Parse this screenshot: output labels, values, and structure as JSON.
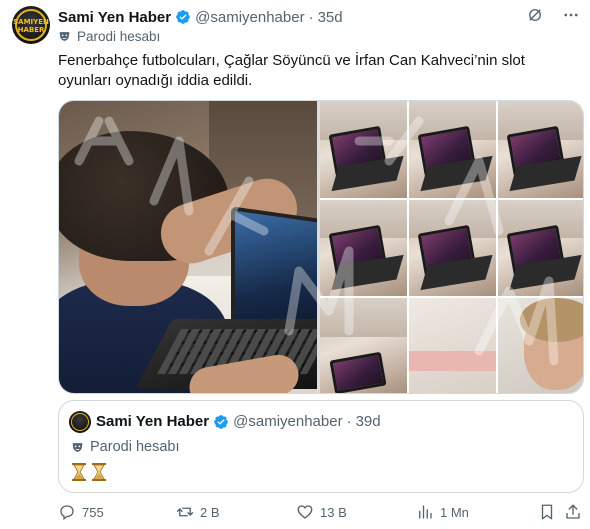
{
  "tweet": {
    "author": {
      "name": "Sami Yen Haber",
      "handle": "@samiyenhaber",
      "separator": "·",
      "time": "35d"
    },
    "avatar_text": [
      "SAMIYEN",
      "HABER"
    ],
    "label": "Parodi hesabı",
    "body": "Fenerbahçe futbolcuları, Çağlar Söyüncü ve İrfan Can Kahveci’nin slot oyunları oynadığı iddia edildi.",
    "header_icons": [
      "grok-icon",
      "more-icon"
    ]
  },
  "quoted": {
    "author": {
      "name": "Sami Yen Haber",
      "handle": "@samiyenhaber",
      "separator": "·",
      "time": "39d"
    },
    "label": "Parodi hesabı",
    "body_icons": [
      "hourglass-icon",
      "hourglass-icon"
    ]
  },
  "actions": {
    "replies": "755",
    "reposts": "2 B",
    "likes": "13 B",
    "views": "1 Mn"
  },
  "colors": {
    "text": "#0f1419",
    "secondary": "#536471",
    "verified": "#1d9bf0",
    "border": "#cfd9de"
  }
}
